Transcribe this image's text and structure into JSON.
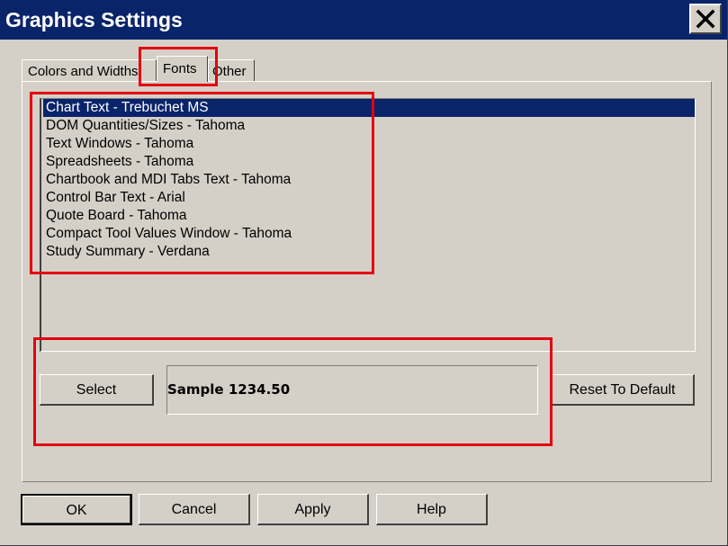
{
  "window": {
    "title": "Graphics Settings"
  },
  "tabs": [
    {
      "label": "Colors and Widths",
      "active": false
    },
    {
      "label": "Fonts",
      "active": true
    },
    {
      "label": "Other",
      "active": false
    }
  ],
  "font_list": {
    "items": [
      "Chart Text - Trebuchet MS",
      "DOM Quantities/Sizes - Tahoma",
      "Text Windows - Tahoma",
      "Spreadsheets - Tahoma",
      "Chartbook and MDI Tabs Text - Tahoma",
      "Control Bar Text - Arial",
      "Quote Board - Tahoma",
      "Compact Tool Values Window - Tahoma",
      "Study Summary - Verdana"
    ],
    "selected_index": 0
  },
  "controls": {
    "select_label": "Select",
    "sample_text": "Sample 1234.50",
    "reset_label": "Reset To Default"
  },
  "footer": {
    "ok_label": "OK",
    "cancel_label": "Cancel",
    "apply_label": "Apply",
    "help_label": "Help"
  },
  "colors": {
    "title_bar": "#0a246a",
    "selection": "#0a246a",
    "dialog_face": "#d4d0c8",
    "annotation": "#e3000f"
  },
  "icons": {
    "close": "close-x-icon"
  }
}
